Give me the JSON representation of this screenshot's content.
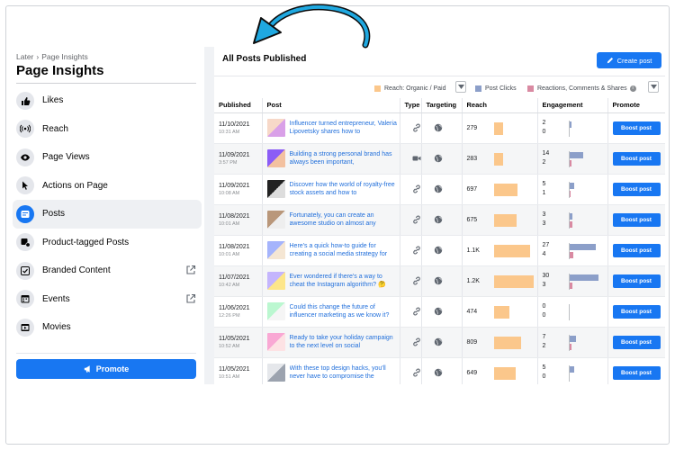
{
  "sidebar": {
    "breadcrumb": {
      "parent": "Later",
      "separator": "›",
      "current": "Page Insights"
    },
    "title": "Page Insights",
    "items": [
      {
        "label": "Likes",
        "icon": "thumbs-up-icon",
        "active": false,
        "external": false
      },
      {
        "label": "Reach",
        "icon": "signal-icon",
        "active": false,
        "external": false
      },
      {
        "label": "Page Views",
        "icon": "eye-icon",
        "active": false,
        "external": false
      },
      {
        "label": "Actions on Page",
        "icon": "cursor-icon",
        "active": false,
        "external": false
      },
      {
        "label": "Posts",
        "icon": "post-icon",
        "active": true,
        "external": false
      },
      {
        "label": "Product-tagged Posts",
        "icon": "tag-icon",
        "active": false,
        "external": false
      },
      {
        "label": "Branded Content",
        "icon": "handshake-icon",
        "active": false,
        "external": true
      },
      {
        "label": "Events",
        "icon": "calendar-icon",
        "active": false,
        "external": true
      },
      {
        "label": "Movies",
        "icon": "film-icon",
        "active": false,
        "external": false
      }
    ],
    "promote_label": "Promote"
  },
  "main": {
    "title": "All Posts Published",
    "create_label": "Create post",
    "legend": {
      "reach": "Reach: Organic / Paid",
      "clicks": "Post Clicks",
      "reactions": "Reactions, Comments & Shares"
    },
    "columns": [
      "Published",
      "Post",
      "Type",
      "Targeting",
      "Reach",
      "Engagement",
      "Promote"
    ],
    "boost_label": "Boost post",
    "rows": [
      {
        "date": "11/10/2021",
        "time": "10:31 AM",
        "text": "Influencer turned entrepreneur, Valeria Lipovetsky shares how to",
        "type": "link",
        "reach": "279",
        "reach_value": 279,
        "eng1": "2",
        "eng2": "0",
        "thumb": [
          "#f7d8c8",
          "#d9a0e8"
        ]
      },
      {
        "date": "11/09/2021",
        "time": "3:57 PM",
        "text": "Building a strong personal brand has always been important,",
        "type": "video",
        "reach": "283",
        "reach_value": 283,
        "eng1": "14",
        "eng2": "2",
        "thumb": [
          "#8b5cf6",
          "#f3c1a0"
        ]
      },
      {
        "date": "11/09/2021",
        "time": "10:08 AM",
        "text": "Discover how the world of royalty-free stock assets and how to",
        "type": "link",
        "reach": "697",
        "reach_value": 697,
        "eng1": "5",
        "eng2": "1",
        "thumb": [
          "#222222",
          "#dddddd"
        ]
      },
      {
        "date": "11/08/2021",
        "time": "10:01 AM",
        "text": "Fortunately, you can create an awesome studio on almost any",
        "type": "link",
        "reach": "675",
        "reach_value": 675,
        "eng1": "3",
        "eng2": "3",
        "thumb": [
          "#b9977a",
          "#eeeeee"
        ]
      },
      {
        "date": "11/08/2021",
        "time": "10:01 AM",
        "text": "Here's a quick how-to guide for creating a social media strategy for",
        "type": "link",
        "reach": "1.1K",
        "reach_value": 1100,
        "eng1": "27",
        "eng2": "4",
        "thumb": [
          "#a5b4fc",
          "#f5e6d3"
        ]
      },
      {
        "date": "11/07/2021",
        "time": "10:42 AM",
        "text": "Ever wondered if there's a way to cheat the Instagram algorithm? 🤔",
        "type": "link",
        "reach": "1.2K",
        "reach_value": 1200,
        "eng1": "30",
        "eng2": "3",
        "thumb": [
          "#c4b5fd",
          "#fde68a"
        ]
      },
      {
        "date": "11/06/2021",
        "time": "12:26 PM",
        "text": "Could this change the future of influencer marketing as we know it?",
        "type": "link",
        "reach": "474",
        "reach_value": 474,
        "eng1": "0",
        "eng2": "0",
        "thumb": [
          "#bbf7d0",
          "#f5f5f5"
        ]
      },
      {
        "date": "11/05/2021",
        "time": "10:52 AM",
        "text": "Ready to take your holiday campaign to the next level on social",
        "type": "link",
        "reach": "809",
        "reach_value": 809,
        "eng1": "7",
        "eng2": "2",
        "thumb": [
          "#f9a8d4",
          "#fde2e4"
        ]
      },
      {
        "date": "11/05/2021",
        "time": "10:51 AM",
        "text": "With these top design hacks, you'll never have to compromise the",
        "type": "link",
        "reach": "649",
        "reach_value": 649,
        "eng1": "5",
        "eng2": "0",
        "thumb": [
          "#e5e7eb",
          "#9ca3af"
        ]
      }
    ]
  },
  "colors": {
    "accent": "#1877f2",
    "reach_bar": "#fbc78b",
    "clicks_bar": "#8c9fc9",
    "reactions_bar": "#d98aa2",
    "arrow": "#1fa8e0"
  }
}
